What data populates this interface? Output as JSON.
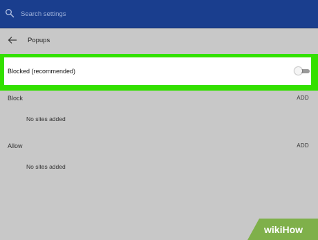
{
  "search": {
    "placeholder": "Search settings",
    "icon": "search-icon"
  },
  "header": {
    "title": "Popups",
    "back_icon": "arrow-left-icon"
  },
  "colors": {
    "topbar": "#1a3e8e",
    "background": "#c8c8c8",
    "highlight": "#33e000",
    "row": "#ffffff"
  },
  "setting": {
    "label": "Blocked (recommended)",
    "toggle_on": false
  },
  "sections": {
    "block": {
      "heading": "Block",
      "add_label": "ADD",
      "empty_text": "No sites added"
    },
    "allow": {
      "heading": "Allow",
      "add_label": "ADD",
      "empty_text": "No sites added"
    }
  },
  "watermark": {
    "text": "wikiHow"
  }
}
